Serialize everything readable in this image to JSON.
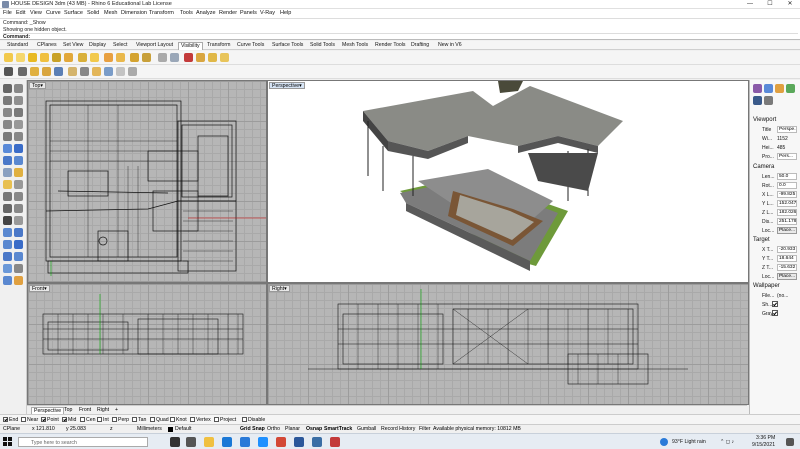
{
  "window": {
    "title": "HOUSE DESIGN 3dm (43 MB) - Rhino 6 Educational Lab License",
    "minimize": "—",
    "maximize": "☐",
    "close": "✕"
  },
  "menu": [
    "File",
    "Edit",
    "View",
    "Curve",
    "Surface",
    "Solid",
    "Mesh",
    "Dimension",
    "Transform",
    "Tools",
    "Analyze",
    "Render",
    "Panels",
    "V-Ray",
    "Help"
  ],
  "command_history": [
    "Command: _Show",
    "Showing one hidden object."
  ],
  "command_prompt": "Command:",
  "tabs": [
    "Standard",
    "CPlanes",
    "Set View",
    "Display",
    "Select",
    "Viewport Layout",
    "Visibility",
    "Transform",
    "Curve Tools",
    "Surface Tools",
    "Solid Tools",
    "Mesh Tools",
    "Render Tools",
    "Drafting",
    "New in V6"
  ],
  "active_tab": "Visibility",
  "viewports": {
    "top": "Top",
    "perspective": "Perspective",
    "front": "Front",
    "right": "Right",
    "menu_arrow": "▾"
  },
  "view_tabs": [
    "Perspective",
    "Top",
    "Front",
    "Right"
  ],
  "view_tabs_add": "+",
  "osnaps": [
    {
      "label": "End",
      "on": true
    },
    {
      "label": "Near",
      "on": false
    },
    {
      "label": "Point",
      "on": true
    },
    {
      "label": "Mid",
      "on": true
    },
    {
      "label": "Cen",
      "on": false
    },
    {
      "label": "Int",
      "on": false
    },
    {
      "label": "Perp",
      "on": false
    },
    {
      "label": "Tan",
      "on": false
    },
    {
      "label": "Quad",
      "on": false
    },
    {
      "label": "Knot",
      "on": false
    },
    {
      "label": "Vertex",
      "on": false
    },
    {
      "label": "Project",
      "on": false
    },
    {
      "label": "Disable",
      "on": false
    }
  ],
  "status": {
    "cplane": "CPlane",
    "x": "x 121.810",
    "y": "y 25.083",
    "z": "z",
    "units": "Millimeters",
    "layer": "Default",
    "grid_snap": "Grid Snap",
    "ortho": "Ortho",
    "planar": "Planar",
    "osnap": "Osnap",
    "smarttrack": "SmartTrack",
    "gumball": "Gumball",
    "record_history": "Record History",
    "filter": "Filter",
    "memory": "Available physical memory: 10812 MB"
  },
  "properties": {
    "viewport_heading": "Viewport",
    "viewport_rows": [
      {
        "label": "Title",
        "value": "Perspe..."
      },
      {
        "label": "Wi...",
        "value": "1152"
      },
      {
        "label": "Hei...",
        "value": "485"
      },
      {
        "label": "Pro...",
        "value": "Pers..."
      }
    ],
    "camera_heading": "Camera",
    "camera_rows": [
      {
        "label": "Len...",
        "value": "50.0"
      },
      {
        "label": "Rot...",
        "value": "0.0"
      },
      {
        "label": "X L...",
        "value": "-99.825"
      },
      {
        "label": "Y L...",
        "value": "152.047"
      },
      {
        "label": "Z L...",
        "value": "182.026"
      },
      {
        "label": "Dis...",
        "value": "251.178"
      }
    ],
    "camera_loc_label": "Loc...",
    "place_button": "Place...",
    "target_heading": "Target",
    "target_rows": [
      {
        "label": "X T...",
        "value": "-20.933"
      },
      {
        "label": "Y T...",
        "value": "18.644"
      },
      {
        "label": "Z T...",
        "value": "-15.632"
      }
    ],
    "target_loc_label": "Loc...",
    "wallpaper_heading": "Wallpaper",
    "wallpaper_file_label": "File...",
    "wallpaper_file_value": "(no...",
    "wallpaper_show_label": "Sh...",
    "wallpaper_gray_label": "Gray"
  },
  "taskbar": {
    "search_placeholder": "Type here to search",
    "weather": "93°F  Light rain",
    "time": "3:36 PM",
    "date": "9/15/2021"
  }
}
